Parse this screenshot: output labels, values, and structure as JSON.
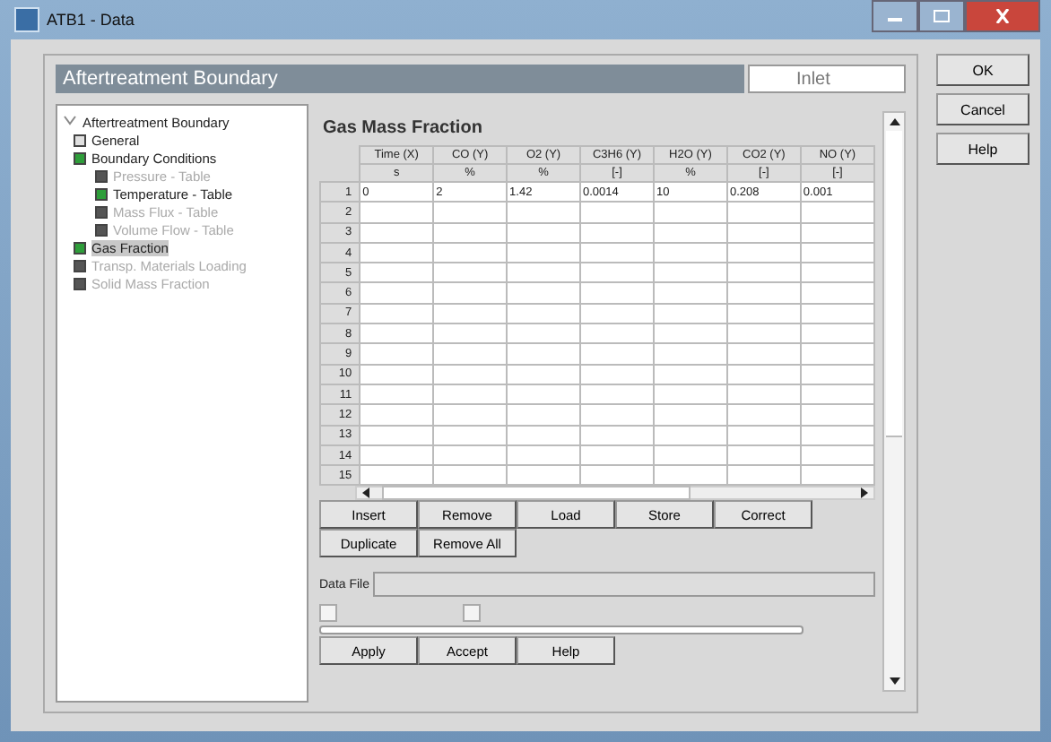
{
  "window": {
    "title": "ATB1 - Data"
  },
  "header": {
    "title": "Aftertreatment Boundary",
    "value": "Inlet"
  },
  "side_buttons": [
    "OK",
    "Cancel",
    "Help"
  ],
  "tree": [
    {
      "label": "Aftertreatment Boundary",
      "expanded": true,
      "children": [
        {
          "label": "General",
          "color": "#e0e0e0",
          "disabled": false,
          "selected": false
        },
        {
          "label": "Boundary Conditions",
          "color": "#2e9e3a",
          "disabled": false,
          "selected": false,
          "children": [
            {
              "label": "Pressure - Table",
              "color": "#555555",
              "disabled": true,
              "selected": false
            },
            {
              "label": "Temperature - Table",
              "color": "#2e9e3a",
              "disabled": false,
              "selected": false
            },
            {
              "label": "Mass Flux - Table",
              "color": "#555555",
              "disabled": true,
              "selected": false
            },
            {
              "label": "Volume Flow - Table",
              "color": "#555555",
              "disabled": true,
              "selected": false
            }
          ]
        },
        {
          "label": "Gas Fraction",
          "color": "#2e9e3a",
          "disabled": false,
          "selected": true
        },
        {
          "label": "Transp. Materials Loading",
          "color": "#555555",
          "disabled": true,
          "selected": false
        },
        {
          "label": "Solid Mass Fraction",
          "color": "#555555",
          "disabled": true,
          "selected": false
        }
      ]
    }
  ],
  "section_title": "Gas Mass Fraction",
  "table": {
    "columns": [
      {
        "name": "Time (X)",
        "unit": "s"
      },
      {
        "name": "CO (Y)",
        "unit": "%"
      },
      {
        "name": "O2 (Y)",
        "unit": "%"
      },
      {
        "name": "C3H6 (Y)",
        "unit": "[-]"
      },
      {
        "name": "H2O (Y)",
        "unit": "%"
      },
      {
        "name": "CO2 (Y)",
        "unit": "[-]"
      },
      {
        "name": "NO (Y)",
        "unit": "[-]"
      }
    ],
    "rows": [
      {
        "number": "1",
        "cells": [
          "0",
          "2",
          "1.42",
          "0.0014",
          "10",
          "0.208",
          "0.001"
        ]
      },
      {
        "number": "2",
        "cells": []
      },
      {
        "number": "3",
        "cells": []
      },
      {
        "number": "4",
        "cells": []
      },
      {
        "number": "5",
        "cells": []
      },
      {
        "number": "6",
        "cells": []
      },
      {
        "number": "7",
        "cells": []
      },
      {
        "number": "8",
        "cells": []
      },
      {
        "number": "9",
        "cells": []
      },
      {
        "number": "10",
        "cells": []
      },
      {
        "number": "11",
        "cells": []
      },
      {
        "number": "12",
        "cells": []
      },
      {
        "number": "13",
        "cells": []
      },
      {
        "number": "14",
        "cells": []
      },
      {
        "number": "15",
        "cells": []
      }
    ]
  },
  "table_buttons": [
    [
      "Insert",
      "Remove",
      "Load",
      "Store",
      "Correct"
    ],
    [
      "Duplicate",
      "Remove All"
    ]
  ],
  "data_file": {
    "label": "Data File"
  },
  "options": [
    {
      "checked": false
    },
    {
      "checked": false
    }
  ],
  "bottom_buttons": [
    "Apply",
    "Accept",
    "Help"
  ]
}
